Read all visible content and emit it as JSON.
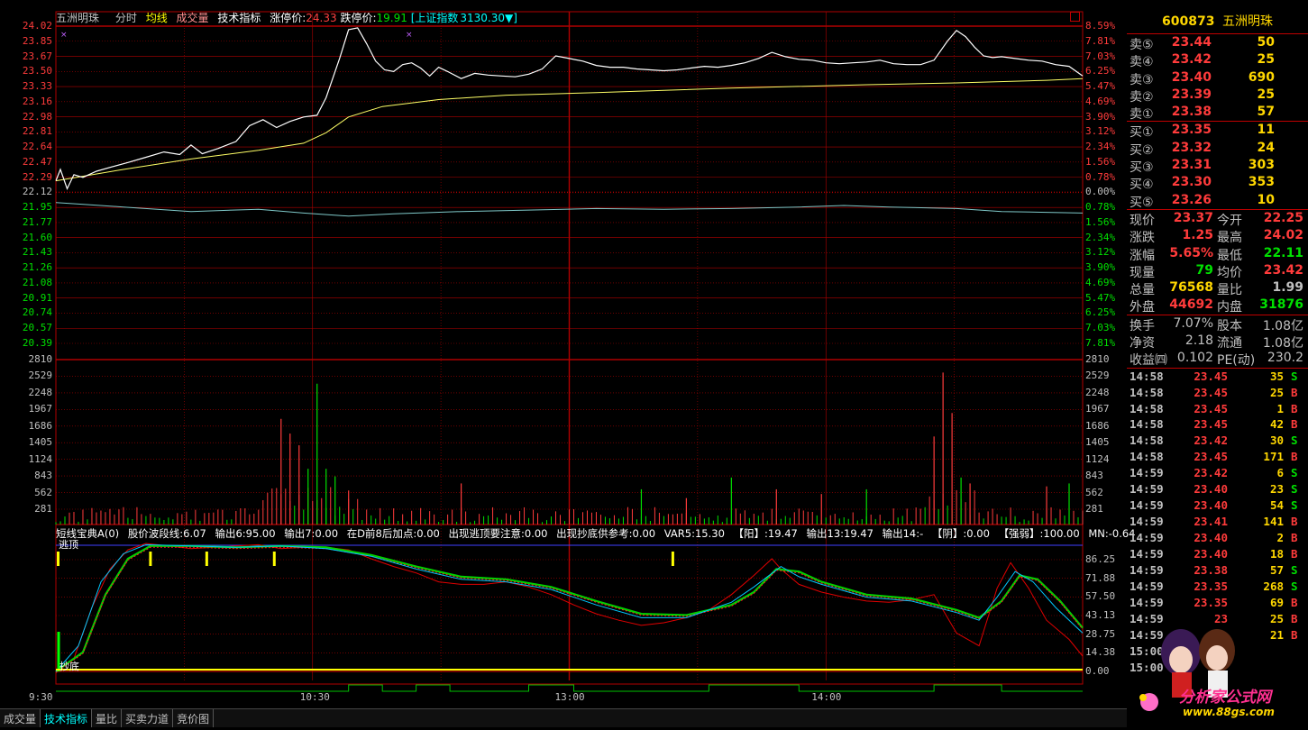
{
  "header": {
    "stock_name": "五洲明珠",
    "tab_minute": "分时",
    "tab_avgline": "均线",
    "tab_volume": "成交量",
    "tab_indicator": "技术指标",
    "limit_up_label": "涨停价:",
    "limit_up_value": "24.33",
    "limit_down_label": "跌停价:",
    "limit_down_value": "19.91",
    "index_label": "[上证指数",
    "index_value": "3130.30▼]"
  },
  "price_axis_left": [
    "24.02",
    "23.85",
    "23.67",
    "23.50",
    "23.33",
    "23.16",
    "22.98",
    "22.81",
    "22.64",
    "22.47",
    "22.29",
    "22.12",
    "21.95",
    "21.77",
    "21.60",
    "21.43",
    "21.26",
    "21.08",
    "20.91",
    "20.74",
    "20.57",
    "20.39"
  ],
  "pct_axis_right": [
    "8.59%",
    "7.81%",
    "7.03%",
    "6.25%",
    "5.47%",
    "4.69%",
    "3.90%",
    "3.12%",
    "2.34%",
    "1.56%",
    "0.78%",
    "0.00%",
    "0.78%",
    "1.56%",
    "2.34%",
    "3.12%",
    "3.90%",
    "4.69%",
    "5.47%",
    "6.25%",
    "7.03%",
    "7.81%"
  ],
  "volume_axis": [
    "2810",
    "2529",
    "2248",
    "1967",
    "1686",
    "1405",
    "1124",
    "843",
    "562",
    "281"
  ],
  "indicator_bar": {
    "name": "短线宝典A(0)",
    "items": [
      "股价波段线:6.07",
      "输出6:95.00",
      "输出7:0.00",
      "在D前8后加点:0.00",
      "出现逃顶要注意:0.00",
      "出现抄底供参考:0.00",
      "VAR5:15.30",
      "【阳】:19.47",
      "输出13:19.47",
      "输出14:-",
      "【阴】:0.00",
      "【强弱】:100.00",
      "MN:-0.64"
    ]
  },
  "indicator_axis": [
    "86.25",
    "71.88",
    "57.50",
    "43.13",
    "28.75",
    "14.38",
    "0.00"
  ],
  "indicator_marks": {
    "escape_top": "逃顶",
    "bottom": "抄底"
  },
  "time_axis": [
    "9:30",
    "10:30",
    "13:00",
    "14:00"
  ],
  "right_panel": {
    "code": "600873",
    "name": "五洲明珠",
    "asks": [
      {
        "label": "卖⑤",
        "price": "23.44",
        "vol": "50"
      },
      {
        "label": "卖④",
        "price": "23.42",
        "vol": "25"
      },
      {
        "label": "卖③",
        "price": "23.40",
        "vol": "690"
      },
      {
        "label": "卖②",
        "price": "23.39",
        "vol": "25"
      },
      {
        "label": "卖①",
        "price": "23.38",
        "vol": "57"
      }
    ],
    "bids": [
      {
        "label": "买①",
        "price": "23.35",
        "vol": "11"
      },
      {
        "label": "买②",
        "price": "23.32",
        "vol": "24"
      },
      {
        "label": "买③",
        "price": "23.31",
        "vol": "303"
      },
      {
        "label": "买④",
        "price": "23.30",
        "vol": "353"
      },
      {
        "label": "买⑤",
        "price": "23.26",
        "vol": "10"
      }
    ],
    "quote": [
      {
        "l1": "现价",
        "v1": "23.37",
        "l2": "今开",
        "v2": "22.25"
      },
      {
        "l1": "涨跌",
        "v1": "1.25",
        "l2": "最高",
        "v2": "24.02"
      },
      {
        "l1": "涨幅",
        "v1": "5.65%",
        "l2": "最低",
        "v2": "22.11"
      },
      {
        "l1": "现量",
        "v1": "79",
        "l2": "均价",
        "v2": "23.42"
      },
      {
        "l1": "总量",
        "v1": "76568",
        "l2": "量比",
        "v2": "1.99"
      },
      {
        "l1": "外盘",
        "v1": "44692",
        "l2": "内盘",
        "v2": "31876"
      }
    ],
    "fundamentals": [
      {
        "l1": "换手",
        "v1": "7.07%",
        "l2": "股本",
        "v2": "1.08亿"
      },
      {
        "l1": "净资",
        "v1": "2.18",
        "l2": "流通",
        "v2": "1.08亿"
      },
      {
        "l1": "收益㈣",
        "v1": "0.102",
        "l2": "PE(动)",
        "v2": "230.2"
      }
    ],
    "ticks": [
      {
        "time": "14:58",
        "price": "23.45",
        "vol": "35",
        "side": "S"
      },
      {
        "time": "14:58",
        "price": "23.45",
        "vol": "25",
        "side": "B"
      },
      {
        "time": "14:58",
        "price": "23.45",
        "vol": "1",
        "side": "B"
      },
      {
        "time": "14:58",
        "price": "23.45",
        "vol": "42",
        "side": "B"
      },
      {
        "time": "14:58",
        "price": "23.42",
        "vol": "30",
        "side": "S"
      },
      {
        "time": "14:58",
        "price": "23.45",
        "vol": "171",
        "side": "B"
      },
      {
        "time": "14:59",
        "price": "23.42",
        "vol": "6",
        "side": "S"
      },
      {
        "time": "14:59",
        "price": "23.40",
        "vol": "23",
        "side": "S"
      },
      {
        "time": "14:59",
        "price": "23.40",
        "vol": "54",
        "side": "S"
      },
      {
        "time": "14:59",
        "price": "23.41",
        "vol": "141",
        "side": "B"
      },
      {
        "time": "14:59",
        "price": "23.40",
        "vol": "2",
        "side": "B"
      },
      {
        "time": "14:59",
        "price": "23.40",
        "vol": "18",
        "side": "B"
      },
      {
        "time": "14:59",
        "price": "23.38",
        "vol": "57",
        "side": "S"
      },
      {
        "time": "14:59",
        "price": "23.35",
        "vol": "268",
        "side": "S"
      },
      {
        "time": "14:59",
        "price": "23.35",
        "vol": "69",
        "side": "B"
      },
      {
        "time": "14:59",
        "price": "23",
        "vol": "25",
        "side": "B"
      },
      {
        "time": "14:59",
        "price": "",
        "vol": "21",
        "side": "B"
      },
      {
        "time": "15:00",
        "price": "",
        "vol": "",
        "side": ""
      },
      {
        "time": "15:00",
        "price": "",
        "vol": "",
        "side": ""
      }
    ]
  },
  "bottom_tabs": [
    "成交量",
    "技术指标",
    "量比",
    "买卖力道",
    "竞价图"
  ],
  "watermark": {
    "text": "分析家公式网",
    "url": "www.88gs.com"
  },
  "colors": {
    "up": "#ff3b3b",
    "down": "#00e000",
    "grid": "#b00000",
    "price_line": "#ffffff",
    "avg_line": "#ffff66",
    "accent": "#ffd700",
    "cyan": "#00ffff"
  },
  "chart_data": {
    "type": "line",
    "title": "五洲明珠",
    "price_series": [
      [
        0,
        22.25
      ],
      [
        2,
        22.38
      ],
      [
        5,
        22.16
      ],
      [
        8,
        22.32
      ],
      [
        12,
        22.29
      ],
      [
        18,
        22.36
      ],
      [
        25,
        22.41
      ],
      [
        32,
        22.46
      ],
      [
        40,
        22.52
      ],
      [
        48,
        22.58
      ],
      [
        55,
        22.55
      ],
      [
        60,
        22.66
      ],
      [
        65,
        22.56
      ],
      [
        72,
        22.62
      ],
      [
        80,
        22.7
      ],
      [
        86,
        22.88
      ],
      [
        92,
        22.95
      ],
      [
        98,
        22.86
      ],
      [
        104,
        22.93
      ],
      [
        110,
        22.98
      ],
      [
        116,
        23.0
      ],
      [
        120,
        23.2
      ],
      [
        126,
        23.65
      ],
      [
        130,
        23.98
      ],
      [
        134,
        24.0
      ],
      [
        138,
        23.82
      ],
      [
        142,
        23.62
      ],
      [
        146,
        23.52
      ],
      [
        150,
        23.5
      ],
      [
        154,
        23.58
      ],
      [
        158,
        23.6
      ],
      [
        162,
        23.54
      ],
      [
        166,
        23.45
      ],
      [
        170,
        23.55
      ],
      [
        174,
        23.5
      ],
      [
        180,
        23.42
      ],
      [
        186,
        23.48
      ],
      [
        192,
        23.46
      ],
      [
        198,
        23.45
      ],
      [
        204,
        23.44
      ],
      [
        210,
        23.47
      ],
      [
        216,
        23.53
      ],
      [
        222,
        23.68
      ],
      [
        228,
        23.65
      ],
      [
        234,
        23.62
      ],
      [
        240,
        23.57
      ],
      [
        246,
        23.55
      ],
      [
        252,
        23.55
      ],
      [
        258,
        23.53
      ],
      [
        264,
        23.52
      ],
      [
        270,
        23.51
      ],
      [
        276,
        23.52
      ],
      [
        282,
        23.54
      ],
      [
        288,
        23.56
      ],
      [
        294,
        23.55
      ],
      [
        300,
        23.57
      ],
      [
        306,
        23.6
      ],
      [
        312,
        23.65
      ],
      [
        318,
        23.72
      ],
      [
        324,
        23.67
      ],
      [
        330,
        23.64
      ],
      [
        336,
        23.63
      ],
      [
        342,
        23.6
      ],
      [
        348,
        23.59
      ],
      [
        354,
        23.6
      ],
      [
        360,
        23.61
      ],
      [
        366,
        23.63
      ],
      [
        372,
        23.59
      ],
      [
        378,
        23.58
      ],
      [
        384,
        23.58
      ],
      [
        390,
        23.63
      ],
      [
        396,
        23.85
      ],
      [
        400,
        23.97
      ],
      [
        404,
        23.9
      ],
      [
        408,
        23.78
      ],
      [
        412,
        23.68
      ],
      [
        416,
        23.66
      ],
      [
        420,
        23.67
      ],
      [
        426,
        23.65
      ],
      [
        432,
        23.63
      ],
      [
        438,
        23.62
      ],
      [
        444,
        23.58
      ],
      [
        450,
        23.56
      ],
      [
        456,
        23.45
      ]
    ],
    "avg_series": [
      [
        0,
        22.25
      ],
      [
        30,
        22.38
      ],
      [
        60,
        22.5
      ],
      [
        90,
        22.6
      ],
      [
        110,
        22.68
      ],
      [
        120,
        22.8
      ],
      [
        130,
        22.98
      ],
      [
        145,
        23.1
      ],
      [
        170,
        23.18
      ],
      [
        200,
        23.23
      ],
      [
        240,
        23.26
      ],
      [
        300,
        23.31
      ],
      [
        360,
        23.35
      ],
      [
        400,
        23.37
      ],
      [
        440,
        23.4
      ],
      [
        456,
        23.42
      ]
    ],
    "pct_series": [
      [
        0,
        0.4
      ],
      [
        10,
        0.3
      ],
      [
        30,
        0.1
      ],
      [
        60,
        -0.2
      ],
      [
        90,
        -0.05
      ],
      [
        110,
        -0.3
      ],
      [
        130,
        -0.5
      ],
      [
        150,
        -0.35
      ],
      [
        180,
        -0.2
      ],
      [
        210,
        -0.1
      ],
      [
        240,
        0.0
      ],
      [
        270,
        -0.05
      ],
      [
        300,
        0.0
      ],
      [
        330,
        0.1
      ],
      [
        350,
        0.2
      ],
      [
        370,
        0.1
      ],
      [
        400,
        0.0
      ],
      [
        420,
        -0.2
      ],
      [
        440,
        -0.25
      ],
      [
        456,
        -0.3
      ]
    ],
    "xlim": [
      0,
      456
    ],
    "ylim": [
      20.39,
      24.02
    ],
    "volume_ylim": [
      0,
      2810
    ],
    "volume_spikes": [
      {
        "i": 100,
        "v": 1800,
        "up": true
      },
      {
        "i": 104,
        "v": 1550,
        "up": true
      },
      {
        "i": 108,
        "v": 1350,
        "up": true
      },
      {
        "i": 112,
        "v": 950,
        "up": false
      },
      {
        "i": 116,
        "v": 2400,
        "up": false
      },
      {
        "i": 120,
        "v": 950,
        "up": false
      },
      {
        "i": 124,
        "v": 820,
        "up": false
      },
      {
        "i": 130,
        "v": 580,
        "up": true
      },
      {
        "i": 180,
        "v": 700,
        "up": true
      },
      {
        "i": 260,
        "v": 600,
        "up": false
      },
      {
        "i": 280,
        "v": 450,
        "up": true
      },
      {
        "i": 300,
        "v": 800,
        "up": false
      },
      {
        "i": 320,
        "v": 600,
        "up": true
      },
      {
        "i": 340,
        "v": 520,
        "up": true
      },
      {
        "i": 360,
        "v": 600,
        "up": false
      },
      {
        "i": 390,
        "v": 1500,
        "up": true
      },
      {
        "i": 394,
        "v": 2590,
        "up": true
      },
      {
        "i": 398,
        "v": 1900,
        "up": true
      },
      {
        "i": 402,
        "v": 800,
        "up": false
      },
      {
        "i": 406,
        "v": 700,
        "up": true
      },
      {
        "i": 440,
        "v": 650,
        "up": true
      },
      {
        "i": 450,
        "v": 700,
        "up": false
      }
    ],
    "indicator_ylim": [
      0,
      100
    ],
    "ind_red": [
      [
        0,
        0
      ],
      [
        8,
        10
      ],
      [
        16,
        50
      ],
      [
        24,
        80
      ],
      [
        32,
        95
      ],
      [
        40,
        100
      ],
      [
        50,
        98
      ],
      [
        60,
        96
      ],
      [
        70,
        97
      ],
      [
        80,
        98
      ],
      [
        90,
        99
      ],
      [
        100,
        96
      ],
      [
        110,
        97
      ],
      [
        120,
        97
      ],
      [
        130,
        95
      ],
      [
        140,
        88
      ],
      [
        150,
        82
      ],
      [
        160,
        77
      ],
      [
        170,
        70
      ],
      [
        180,
        68
      ],
      [
        190,
        68
      ],
      [
        200,
        70
      ],
      [
        210,
        66
      ],
      [
        220,
        60
      ],
      [
        230,
        52
      ],
      [
        240,
        45
      ],
      [
        250,
        40
      ],
      [
        260,
        36
      ],
      [
        270,
        38
      ],
      [
        280,
        42
      ],
      [
        290,
        48
      ],
      [
        300,
        60
      ],
      [
        310,
        75
      ],
      [
        318,
        88
      ],
      [
        322,
        80
      ],
      [
        330,
        68
      ],
      [
        340,
        62
      ],
      [
        350,
        58
      ],
      [
        360,
        55
      ],
      [
        370,
        54
      ],
      [
        380,
        56
      ],
      [
        390,
        60
      ],
      [
        400,
        30
      ],
      [
        410,
        20
      ],
      [
        418,
        65
      ],
      [
        424,
        85
      ],
      [
        432,
        65
      ],
      [
        440,
        40
      ],
      [
        450,
        25
      ],
      [
        456,
        12
      ]
    ],
    "ind_white": [
      [
        0,
        0
      ],
      [
        10,
        20
      ],
      [
        20,
        70
      ],
      [
        30,
        92
      ],
      [
        40,
        99
      ],
      [
        60,
        98
      ],
      [
        80,
        97
      ],
      [
        100,
        98
      ],
      [
        120,
        96
      ],
      [
        140,
        90
      ],
      [
        160,
        80
      ],
      [
        180,
        72
      ],
      [
        200,
        70
      ],
      [
        220,
        64
      ],
      [
        240,
        52
      ],
      [
        260,
        42
      ],
      [
        280,
        42
      ],
      [
        300,
        54
      ],
      [
        310,
        66
      ],
      [
        322,
        82
      ],
      [
        330,
        74
      ],
      [
        340,
        68
      ],
      [
        360,
        58
      ],
      [
        380,
        55
      ],
      [
        400,
        46
      ],
      [
        410,
        40
      ],
      [
        418,
        58
      ],
      [
        426,
        78
      ],
      [
        434,
        70
      ],
      [
        444,
        50
      ],
      [
        456,
        30
      ]
    ],
    "ind_green": [
      [
        0,
        0
      ],
      [
        12,
        15
      ],
      [
        22,
        60
      ],
      [
        32,
        88
      ],
      [
        42,
        98
      ],
      [
        60,
        98
      ],
      [
        80,
        97
      ],
      [
        100,
        98
      ],
      [
        120,
        97
      ],
      [
        140,
        91
      ],
      [
        160,
        82
      ],
      [
        180,
        74
      ],
      [
        200,
        72
      ],
      [
        220,
        66
      ],
      [
        240,
        55
      ],
      [
        260,
        45
      ],
      [
        280,
        44
      ],
      [
        300,
        52
      ],
      [
        310,
        62
      ],
      [
        320,
        80
      ],
      [
        330,
        78
      ],
      [
        340,
        70
      ],
      [
        360,
        60
      ],
      [
        380,
        57
      ],
      [
        400,
        48
      ],
      [
        410,
        42
      ],
      [
        420,
        55
      ],
      [
        428,
        75
      ],
      [
        436,
        72
      ],
      [
        446,
        55
      ],
      [
        456,
        34
      ]
    ]
  }
}
